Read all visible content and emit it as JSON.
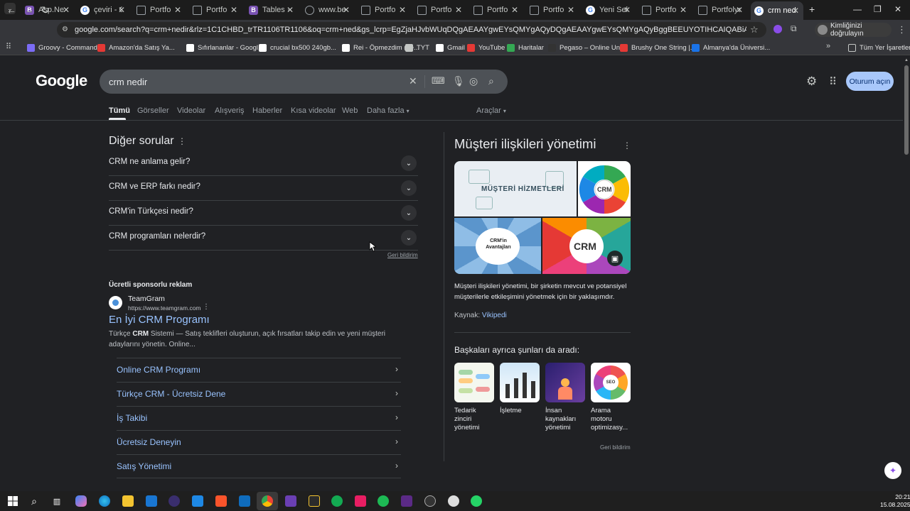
{
  "browser": {
    "tabs": [
      {
        "label": "Asp.Ne",
        "icon": "bootstrap-b",
        "color": "#7952b3"
      },
      {
        "label": "çeviri - G",
        "icon": "google-g",
        "color": "#ffffff"
      },
      {
        "label": "Portfo",
        "icon": "page",
        "color": "#9aa0a6"
      },
      {
        "label": "Portfo",
        "icon": "page",
        "color": "#9aa0a6"
      },
      {
        "label": "Tables · B",
        "icon": "bootstrap-b",
        "color": "#7952b3"
      },
      {
        "label": "www.be",
        "icon": "globe",
        "color": "#9aa0a6"
      },
      {
        "label": "Portfo",
        "icon": "page",
        "color": "#9aa0a6"
      },
      {
        "label": "Portfo",
        "icon": "page",
        "color": "#9aa0a6"
      },
      {
        "label": "Portfo",
        "icon": "page",
        "color": "#9aa0a6"
      },
      {
        "label": "Portfo",
        "icon": "page",
        "color": "#9aa0a6"
      },
      {
        "label": "Yeni Sek",
        "icon": "google-g",
        "color": "#ffffff"
      },
      {
        "label": "Portfo",
        "icon": "page",
        "color": "#9aa0a6"
      },
      {
        "label": "Portfolyo",
        "icon": "page",
        "color": "#9aa0a6"
      },
      {
        "label": "crm nedi",
        "icon": "google-g",
        "color": "#ffffff",
        "active": true
      }
    ],
    "new_tab": "+",
    "url": "google.com/search?q=crm+nedir&rlz=1C1CHBD_trTR1106TR1106&oq=crm+ned&gs_lcrp=EgZjaHJvbWUqDQgAEAAYgwEYsQMYgAQyDQgAEAAYgwEYsQMYgAQyBggBEEUYOTIHCAIQABiABDIHCAMQABiABDIHCAQQABiABDIHC...",
    "profile_label": "Kimliğinizi doğrulayın",
    "bookmarks": [
      {
        "label": "Groovy - Commands",
        "color": "#7b6cf6"
      },
      {
        "label": "Amazon'da Satış Ya...",
        "color": "#e53935"
      },
      {
        "label": "Sıfırlananlar - Googl...",
        "color": "#ffffff"
      },
      {
        "label": "crucial bx500 240gb...",
        "color": "#ffffff"
      },
      {
        "label": "Rei - Öpmezdim (de...",
        "color": "#ffffff"
      },
      {
        "label": "TYT",
        "color": "#c4c7c5"
      },
      {
        "label": "Gmail",
        "color": "#ffffff"
      },
      {
        "label": "YouTube",
        "color": "#e53935"
      },
      {
        "label": "Haritalar",
        "color": "#34a853"
      },
      {
        "label": "Pegaso – Online Uni...",
        "color": "#333333"
      },
      {
        "label": "Brushy One String |...",
        "color": "#e53935"
      },
      {
        "label": "Almanya'da Üniversi...",
        "color": "#1a73e8"
      }
    ],
    "all_bookmarks": "Tüm Yer İşaretleri"
  },
  "google": {
    "logo": "Google",
    "query": "crm nedir",
    "signin_label": "Oturum açın",
    "tabs": [
      "Tümü",
      "Görseller",
      "Videolar",
      "Alışveriş",
      "Haberler",
      "Kısa videolar",
      "Web",
      "Daha fazla"
    ],
    "tools_label": "Araçlar"
  },
  "related_questions": {
    "title": "Diğer sorular",
    "items": [
      "CRM ne anlama gelir?",
      "CRM ve ERP farkı nedir?",
      "CRM'in Türkçesi nedir?",
      "CRM programları nelerdir?"
    ],
    "feedback": "Geri bildirim"
  },
  "ad": {
    "label": "Ücretli sponsorlu reklam",
    "advertiser": "TeamGram",
    "url": "https://www.teamgram.com",
    "title": "En İyi CRM Programı",
    "description_prefix": "Türkçe ",
    "description_bold": "CRM",
    "description_rest": " Sistemi — Satış teklifleri oluşturun, açık fırsatları takip edin ve yeni müşteri adaylarını yönetin. Online...",
    "sitelinks": [
      "Online CRM Programı",
      "Türkçe CRM - Ücretsiz Dene",
      "İş Takibi",
      "Ücretsiz Deneyin",
      "Satış Yönetimi"
    ]
  },
  "knowledge_panel": {
    "title": "Müşteri ilişkileri yönetimi",
    "image_texts": {
      "img1": "MÜŞTERİ HİZMETLERİ",
      "img2": "CRM",
      "img3": "CRM'in Avantajları",
      "img4": "CRM"
    },
    "description": "Müşteri ilişkileri yönetimi, bir şirketin mevcut ve potansiyel müşterilerle etkileşimini yönetmek için bir yaklaşımdır.",
    "source_label": "Kaynak:",
    "source_link": "Vikipedi",
    "also_searched_title": "Başkaları ayrıca şunları da aradı:",
    "also_searched": [
      "Tedarik zinciri yönetimi",
      "İşletme",
      "İnsan kaynakları yönetimi",
      "Arama motoru optimizasy..."
    ],
    "feedback": "Geri bildirim"
  },
  "taskbar": {
    "time": "20:21",
    "date": "15.08.2025"
  }
}
